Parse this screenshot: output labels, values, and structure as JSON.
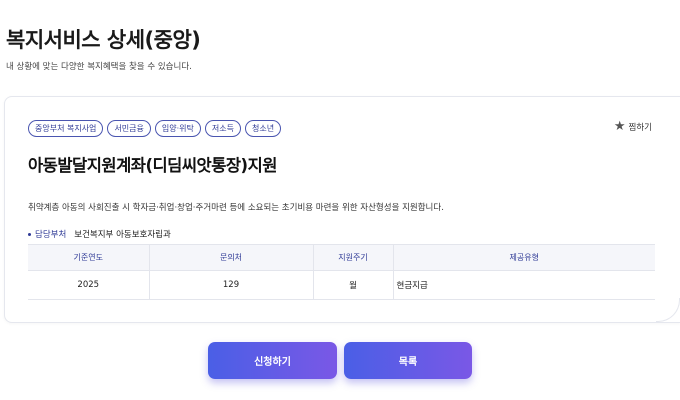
{
  "header": {
    "title": "복지서비스 상세(중앙)",
    "subtitle": "내 상황에 맞는 다양한 복지혜택을 찾을 수 있습니다."
  },
  "card": {
    "tags": [
      "중앙부처 복지사업",
      "서민금융",
      "입양·위탁",
      "저소득",
      "청소년"
    ],
    "bookmark_label": "찜하기",
    "title": "아동발달지원계좌(디딤씨앗통장)지원",
    "description": "취약계층 아동의 사회진출 시 학자금·취업·창업·주거마련 등에 소요되는 초기비용 마련을 위한 자산형성을 지원합니다.",
    "dept_label": "담당부처",
    "dept_value": "보건복지부 아동보호자립과",
    "table": {
      "headers": [
        "기준연도",
        "문의처",
        "지원주기",
        "제공유형"
      ],
      "row": [
        "2025",
        "129",
        "월",
        "현금지급"
      ]
    }
  },
  "actions": {
    "apply_label": "신청하기",
    "list_label": "목록"
  },
  "colors": {
    "accent": "#2f3a96",
    "button_gradient_start": "#4a5fe6",
    "button_gradient_end": "#7a58e6"
  }
}
